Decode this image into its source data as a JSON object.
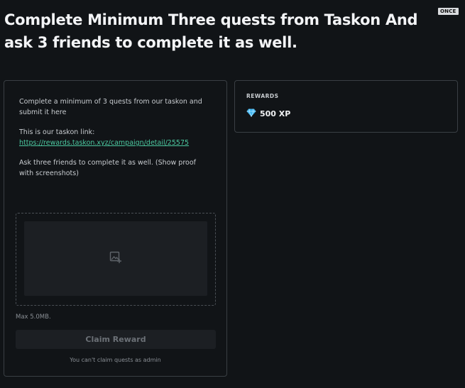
{
  "quest": {
    "title": "Complete Minimum Three quests from Taskon And ask 3 friends to complete it as well.",
    "frequency_badge": "ONCE",
    "description_line1": "Complete a minimum of 3 quests from our taskon and submit it here",
    "link_intro": "This is our taskon link:",
    "link_url": "https://rewards.taskon.xyz/campaign/detail/25575",
    "description_line3": "Ask three friends to complete it as well. (Show proof with screenshots)"
  },
  "upload": {
    "icon": "image-add-icon",
    "max_size_label": "Max 5.0MB."
  },
  "claim": {
    "button_label": "Claim Reward",
    "note": "You can't claim quests as admin"
  },
  "rewards": {
    "label": "REWARDS",
    "icon": "diamond-icon",
    "xp": "500 XP"
  },
  "colors": {
    "background": "#111417",
    "border": "#3a3f44",
    "link": "#4cc9a0",
    "diamond": "#3fb6f2"
  }
}
